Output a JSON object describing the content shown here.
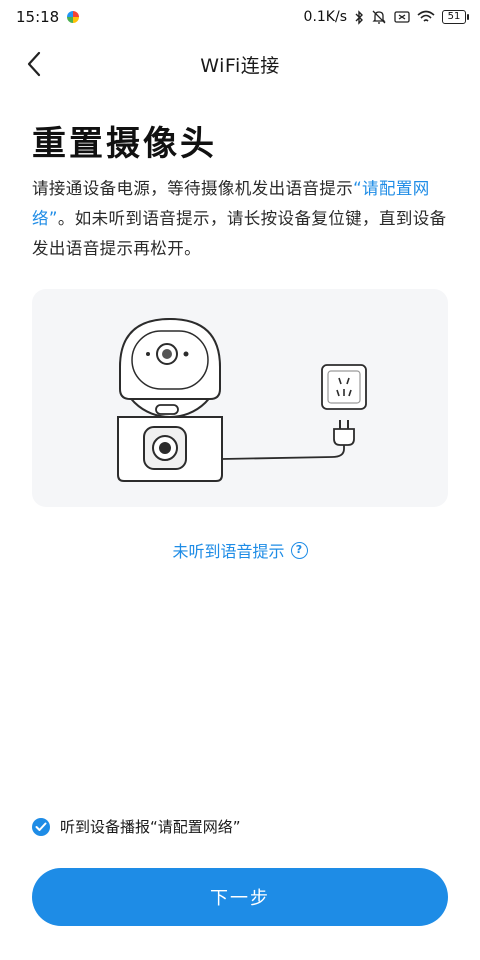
{
  "status_bar": {
    "time": "15:18",
    "network_speed": "0.1K/s",
    "battery": "51",
    "icons": [
      "bluetooth-icon",
      "mute-icon",
      "sim-off-icon",
      "wifi-icon",
      "battery-icon"
    ]
  },
  "header": {
    "title": "WiFi连接",
    "back_icon": "chevron-left-icon"
  },
  "main": {
    "heading": "重置摄像头",
    "description_part1": "请接通设备电源，等待摄像机发出语音提示",
    "description_highlight": "“请配置网络”",
    "description_part2": "。如未听到语音提示，请长按设备复位键，直到设备发出语音提示再松开。",
    "help_link": "未听到语音提示",
    "help_icon": "question-circle-icon"
  },
  "footer": {
    "confirm_label": "听到设备播报“请配置网络”",
    "confirm_checked": true,
    "next_button": "下一步"
  },
  "colors": {
    "accent": "#1e8ce6",
    "text": "#1a1a1a",
    "illustration_bg": "#f5f6f8"
  }
}
